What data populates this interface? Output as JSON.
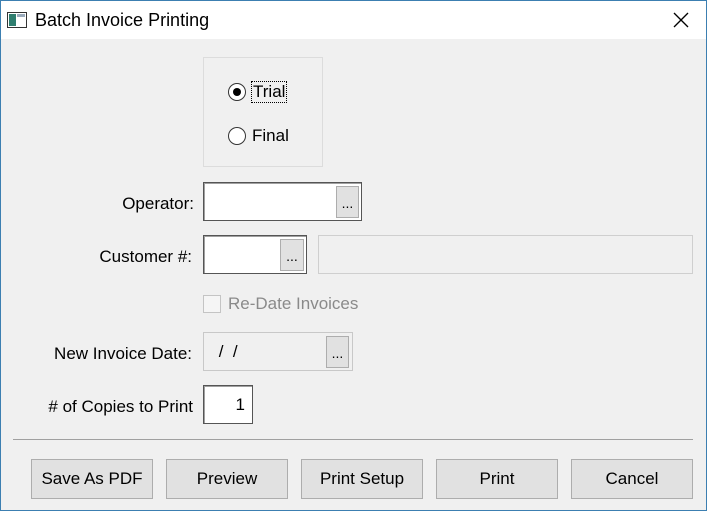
{
  "window": {
    "title": "Batch Invoice Printing",
    "close_symbol": "✕",
    "icon": "app-window-icon"
  },
  "mode": {
    "options": [
      {
        "label": "Trial",
        "checked": true
      },
      {
        "label": "Final",
        "checked": false
      }
    ]
  },
  "form": {
    "operator_label": "Operator:",
    "operator_value": "",
    "customer_label": "Customer #:",
    "customer_value": "",
    "customer_name_value": "",
    "redate_label": "Re-Date Invoices",
    "redate_checked": false,
    "new_date_label": "New Invoice Date:",
    "new_date_value": " /  /",
    "copies_label": "# of Copies to Print",
    "copies_value": "1",
    "lookup_label": "..."
  },
  "buttons": {
    "save_pdf": "Save As PDF",
    "preview": "Preview",
    "print_setup": "Print Setup",
    "print": "Print",
    "cancel": "Cancel"
  },
  "colors": {
    "window_border": "#3c7fb1",
    "dialog_bg": "#f0f0f0",
    "button_bg": "#e1e1e1"
  }
}
